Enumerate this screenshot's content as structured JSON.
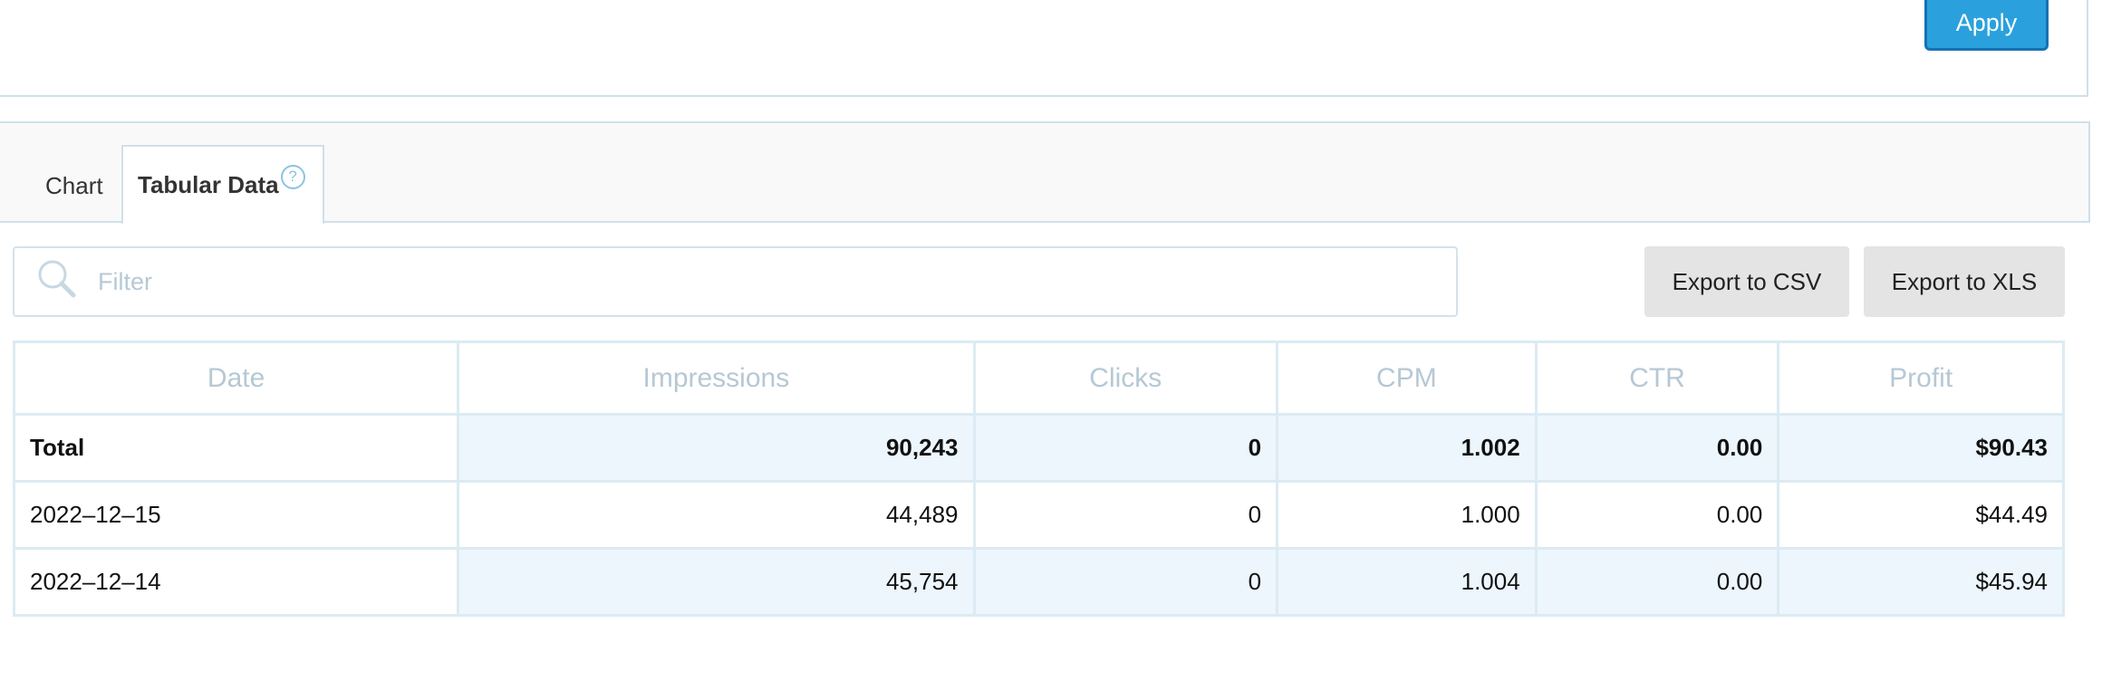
{
  "filters": {
    "apply_label": "Apply"
  },
  "tabs": [
    {
      "label": "Chart",
      "active": false
    },
    {
      "label": "Tabular Data",
      "active": true,
      "help_symbol": "?"
    }
  ],
  "filter": {
    "placeholder": "Filter",
    "value": ""
  },
  "export": {
    "csv_label": "Export to CSV",
    "xls_label": "Export to XLS"
  },
  "table": {
    "columns": [
      "Date",
      "Impressions",
      "Clicks",
      "CPM",
      "CTR",
      "Profit"
    ],
    "total": {
      "date": "Total",
      "impressions": "90,243",
      "clicks": "0",
      "cpm": "1.002",
      "ctr": "0.00",
      "profit": "$90.43"
    },
    "rows": [
      {
        "date": "2022–12–15",
        "impressions": "44,489",
        "clicks": "0",
        "cpm": "1.000",
        "ctr": "0.00",
        "profit": "$44.49"
      },
      {
        "date": "2022–12–14",
        "impressions": "45,754",
        "clicks": "0",
        "cpm": "1.004",
        "ctr": "0.00",
        "profit": "$45.94"
      }
    ]
  },
  "colors": {
    "accent": "#2aa1dc",
    "accent_border": "#1672b4",
    "row_shade": "#ecf6fc",
    "header_text": "#b6c8d4"
  }
}
